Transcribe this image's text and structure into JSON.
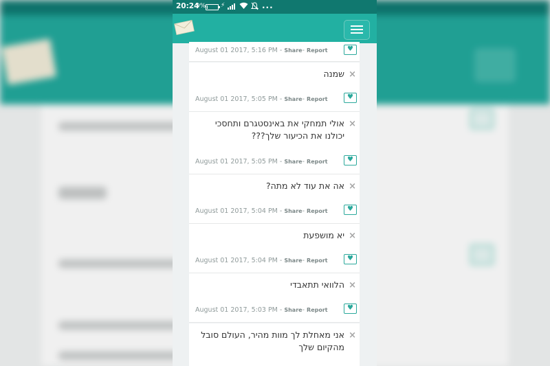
{
  "status_bar": {
    "time": "20:24",
    "battery_percent": "9%",
    "battery_level": 0.09,
    "icons": [
      "battery-icon",
      "charging-icon",
      "signal-icon",
      "wifi-icon",
      "mute-icon",
      "more-icon"
    ],
    "more": "..."
  },
  "app_bar": {
    "logo_icon": "envelope-icon",
    "menu_icon": "hamburger-menu-icon",
    "color": "#22b0a2"
  },
  "messages": [
    {
      "text": "",
      "date": "August 01 2017, 5:16 PM",
      "share": "Share",
      "report": "Report"
    },
    {
      "text": "שמנה",
      "date": "August 01 2017, 5:05 PM",
      "share": "Share",
      "report": "Report"
    },
    {
      "text": "אולי תמחקי את באינסטגרם ותחסכי יכולנו את הכיעור שלך???",
      "date": "August 01 2017, 5:05 PM",
      "share": "Share",
      "report": "Report"
    },
    {
      "text": "אה את עוד לא מתה?",
      "date": "August 01 2017, 5:04 PM",
      "share": "Share",
      "report": "Report"
    },
    {
      "text": "יא מושפעת",
      "date": "August 01 2017, 5:04 PM",
      "share": "Share",
      "report": "Report"
    },
    {
      "text": "הלוואי תתאבדי",
      "date": "August 01 2017, 5:03 PM",
      "share": "Share",
      "report": "Report"
    },
    {
      "text": "אני מאחלת לך מוות מהיר, העולם סובל מהקיום שלך",
      "date": "",
      "share": "",
      "report": ""
    }
  ],
  "separators": {
    "date_share": " - ",
    "share_report": "- "
  },
  "close_symbol": "×",
  "heart_symbol": "♥",
  "colors": {
    "teal": "#22b0a2",
    "status_teal": "#10786f",
    "heart": "#2aa89b"
  }
}
